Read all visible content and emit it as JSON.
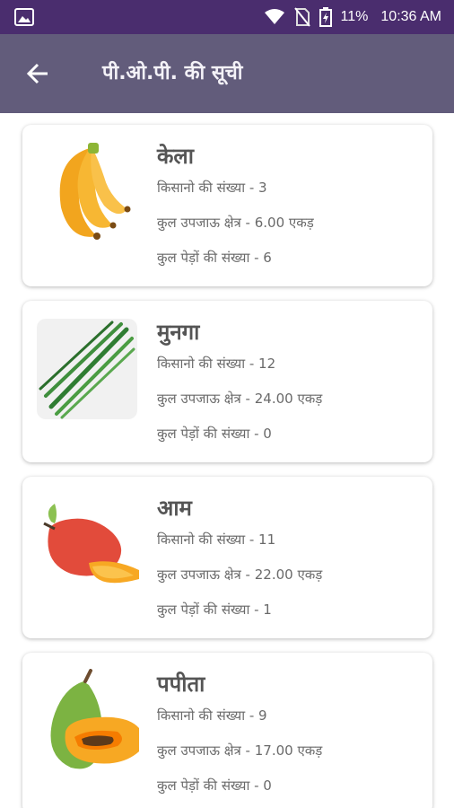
{
  "status_bar": {
    "battery": "11%",
    "time": "10:36 AM",
    "icons": [
      "image-icon",
      "wifi-icon",
      "no-sim-icon",
      "battery-charging-icon"
    ]
  },
  "app_bar": {
    "back_icon": "arrow-left-icon",
    "title": "पी.ओ.पी. की सूची"
  },
  "labels": {
    "farmers": "किसानो की संख्या - ",
    "area": "कुल उपजाऊ क्षेत्र - ",
    "trees": "कुल पेड़ों की संख्या - "
  },
  "crops": [
    {
      "name": "केला",
      "farmers": "3",
      "area": "6.00 एकड़",
      "trees": "6",
      "image": "banana-icon"
    },
    {
      "name": "मुनगा",
      "farmers": "12",
      "area": "24.00 एकड़",
      "trees": "0",
      "image": "drumstick-icon"
    },
    {
      "name": "आम",
      "farmers": "11",
      "area": "22.00 एकड़",
      "trees": "1",
      "image": "mango-icon"
    },
    {
      "name": "पपीता",
      "farmers": "9",
      "area": "17.00 एकड़",
      "trees": "0",
      "image": "papaya-icon"
    }
  ],
  "colors": {
    "status_bar": "#4a2d6e",
    "app_bar": "#625c7b",
    "card": "#ffffff"
  }
}
